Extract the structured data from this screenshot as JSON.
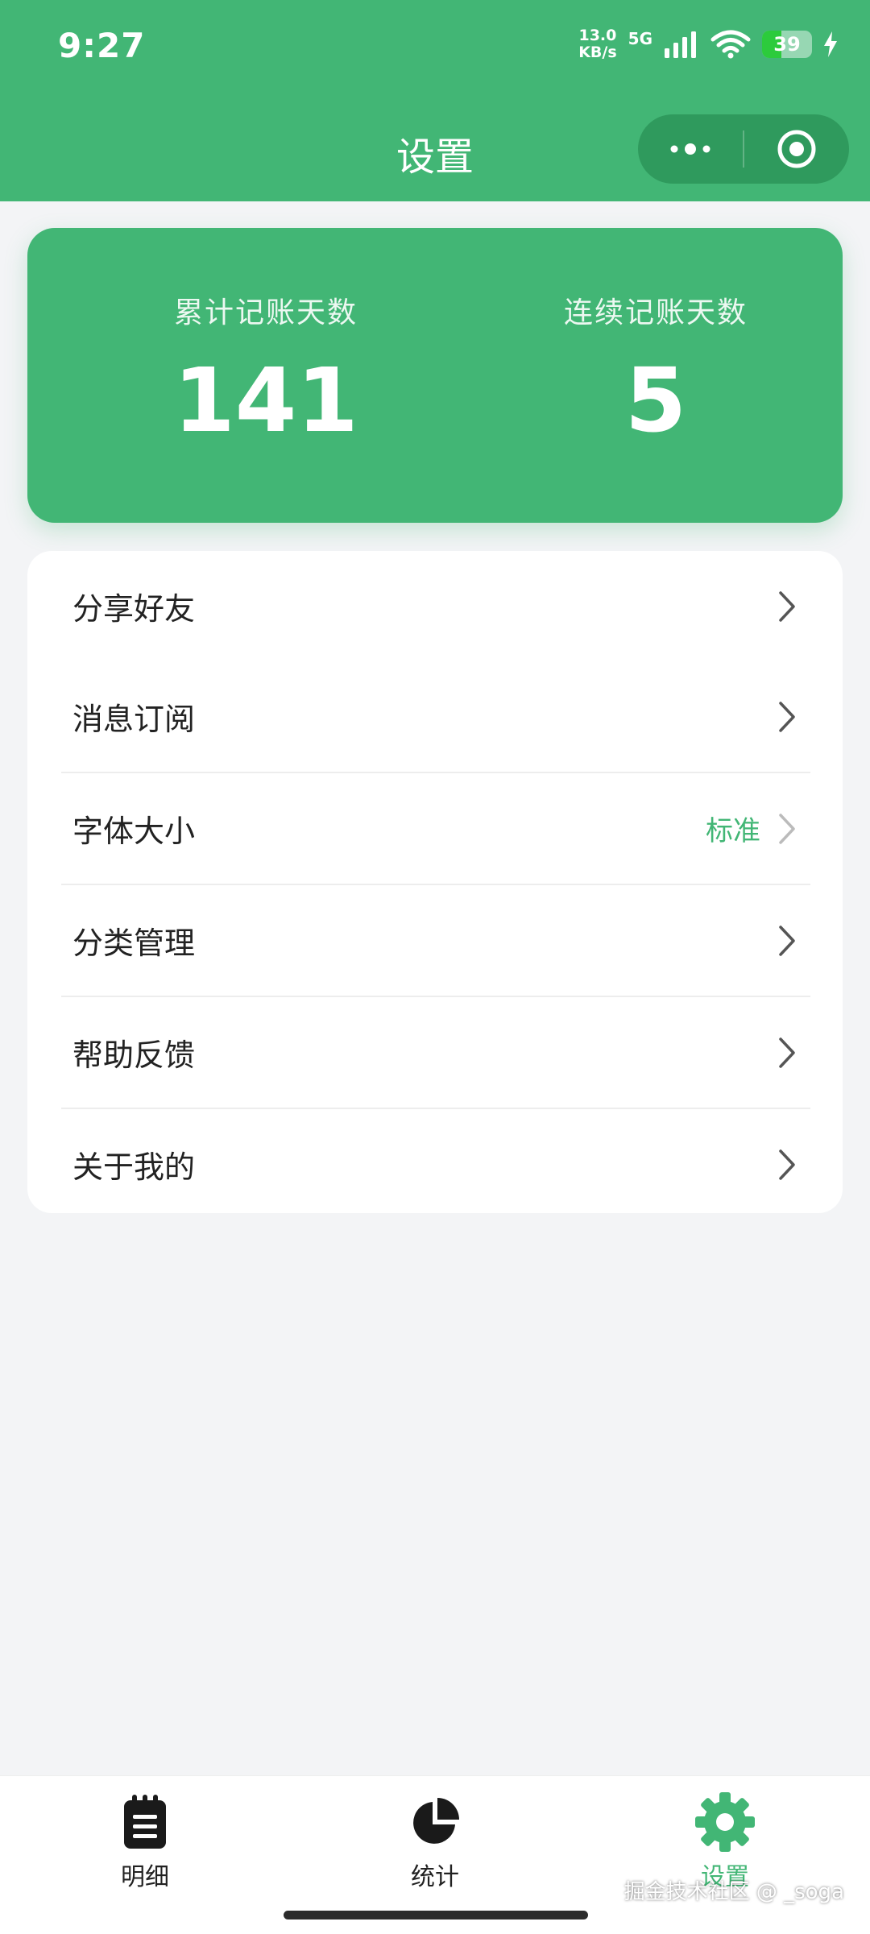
{
  "status_bar": {
    "time": "9:27",
    "net_speed_value": "13.0",
    "net_speed_unit": "KB/s",
    "network_type": "5G",
    "battery": "39",
    "battery_fraction": 0.39
  },
  "nav": {
    "title": "设置",
    "more_icon": "ellipsis-icon",
    "close_icon": "target-circle-icon"
  },
  "stats": {
    "total_days_label": "累计记账天数",
    "total_days_value": "141",
    "streak_days_label": "连续记账天数",
    "streak_days_value": "5"
  },
  "menu": [
    {
      "label": "分享好友",
      "value": ""
    },
    {
      "label": "消息订阅",
      "value": ""
    },
    {
      "label": "字体大小",
      "value": "标准"
    },
    {
      "label": "分类管理",
      "value": ""
    },
    {
      "label": "帮助反馈",
      "value": ""
    },
    {
      "label": "关于我的",
      "value": ""
    }
  ],
  "tabs": [
    {
      "label": "明细",
      "icon": "notepad-icon",
      "active": false
    },
    {
      "label": "统计",
      "icon": "pie-chart-icon",
      "active": false
    },
    {
      "label": "设置",
      "icon": "gear-icon",
      "active": true
    }
  ],
  "watermark": "掘金技术社区 @ _soga",
  "colors": {
    "brand": "#42b675",
    "background": "#f3f4f6",
    "text": "#222222"
  }
}
